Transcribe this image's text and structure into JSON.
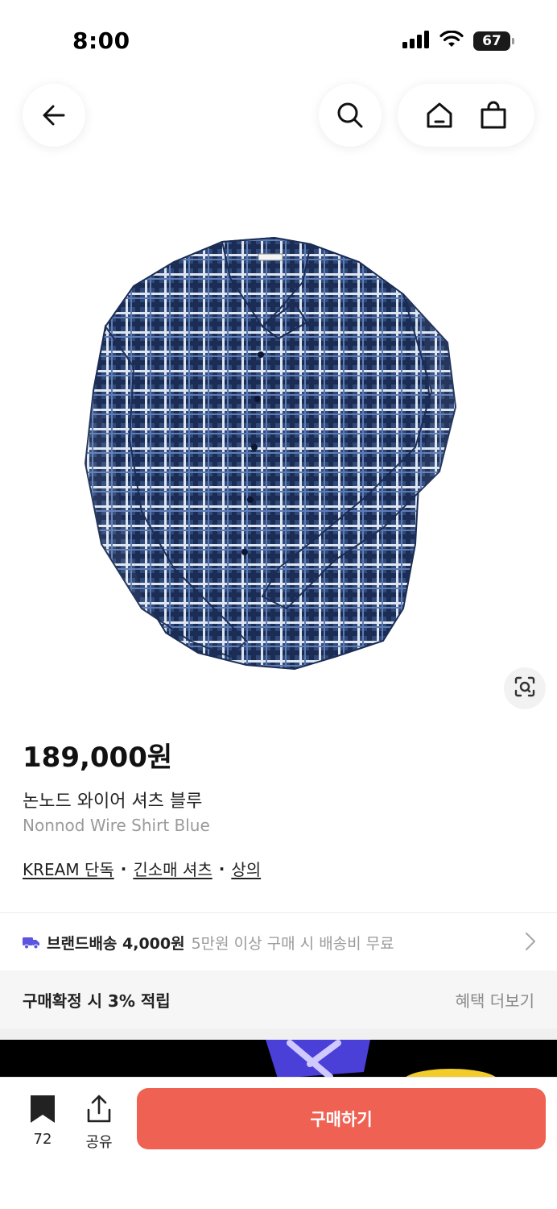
{
  "status_bar": {
    "time": "8:00",
    "battery": "67"
  },
  "nav": {
    "back_icon": "arrow-left-icon",
    "search_icon": "search-icon",
    "home_icon": "home-icon",
    "bag_icon": "shopping-bag-icon"
  },
  "product": {
    "image_desc_icon": "product-photo",
    "price": "189,000원",
    "title_ko": "논노드 와이어 셔츠 블루",
    "title_en": "Nonnod Wire Shirt Blue",
    "tags": [
      "KREAM 단독",
      "긴소매 셔츠",
      "상의"
    ],
    "tag_separator": "·"
  },
  "shipping": {
    "label": "브랜드배송 4,000원",
    "note": "5만원 이상 구매 시 배송비 무료"
  },
  "benefit": {
    "text": "구매확정 시 3% 적립",
    "more": "혜택 더보기"
  },
  "bottom_bar": {
    "save_count": "72",
    "share_label": "공유",
    "buy_label": "구매하기"
  },
  "colors": {
    "buy_button": "#ef6253",
    "truck_icon": "#5b55e0",
    "shirt_base": "#2f4a78"
  }
}
